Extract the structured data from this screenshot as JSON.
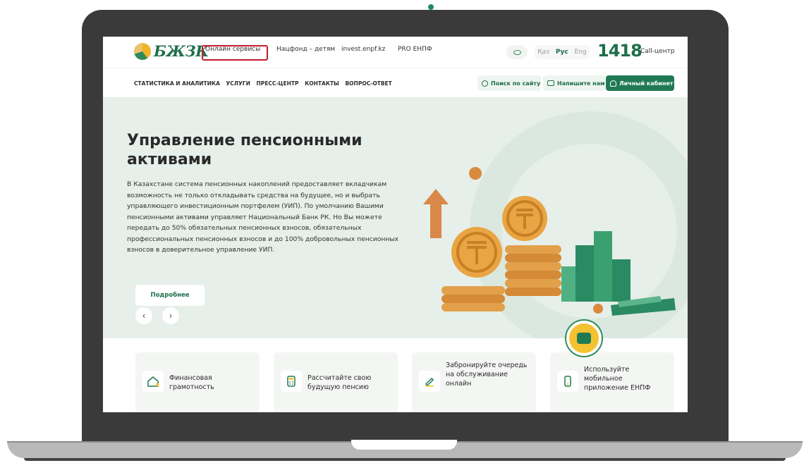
{
  "brand": {
    "logo_text": "БЖЗК",
    "accent": "#1f7a54"
  },
  "top_nav": [
    {
      "label": "Онлайн сервисы"
    },
    {
      "label": "Нацфонд – детям"
    },
    {
      "label": "invest.enpf.kz"
    },
    {
      "label": "PRO ЕНПФ"
    }
  ],
  "languages": {
    "kaz": "Қаз",
    "rus": "Рус",
    "eng": "Eng"
  },
  "call_center": {
    "number": "1418",
    "label": "Call-центр"
  },
  "main_nav": [
    {
      "label": "СТАТИСТИКА И АНАЛИТИКА"
    },
    {
      "label": "УСЛУГИ"
    },
    {
      "label": "ПРЕСС-ЦЕНТР"
    },
    {
      "label": "КОНТАКТЫ"
    },
    {
      "label": "ВОПРОС-ОТВЕТ"
    }
  ],
  "header_buttons": {
    "search": "Поиск по сайту",
    "write": "Напишите нам",
    "cabinet": "Личный кабинет"
  },
  "hero": {
    "title": "Управление пенсионными активами",
    "text": "В Казахстане система пенсионных накоплений предоставляет вкладчикам возможность не только откладывать средства на будущее, но и выбрать управляющего инвестиционным портфелем (УИП). По умолчанию Вашими пенсионными активами управляет Национальный Банк РК. Но Вы можете передать до 50% обязательных пенсионных взносов, обязательных профессиональных пенсионных взносов и до 100% добровольных пенсионных взносов в доверительное управление УИП.",
    "more_label": "Подробнее",
    "prev": "‹",
    "next": "›"
  },
  "cards": [
    {
      "label": "Финансовая грамотность",
      "icon": "house-icon"
    },
    {
      "label": "Рассчитайте свою будущую пенсию",
      "icon": "calculator-icon"
    },
    {
      "label": "Забронируйте очередь на обслуживание онлайн",
      "icon": "pen-icon"
    },
    {
      "label": "Используйте мобильное приложение ЕНПФ",
      "icon": "phone-icon"
    }
  ]
}
